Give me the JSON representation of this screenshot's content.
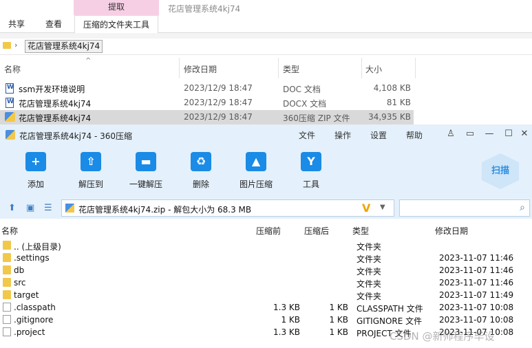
{
  "ribbon": {
    "context_tab": "提取",
    "window_title": "花店管理系统4kj74",
    "tabs": [
      "共享",
      "查看",
      "压缩的文件夹工具"
    ]
  },
  "address": {
    "crumb": "花店管理系统4kj74"
  },
  "explorer": {
    "columns": {
      "name": "名称",
      "date": "修改日期",
      "type": "类型",
      "size": "大小"
    },
    "rows": [
      {
        "name": "ssm开发环境说明",
        "date": "2023/12/9 18:47",
        "type": "DOC 文档",
        "size": "4,108 KB"
      },
      {
        "name": "花店管理系统4kj74",
        "date": "2023/12/9 18:47",
        "type": "DOCX 文档",
        "size": "81 KB"
      },
      {
        "name": "花店管理系统4kj74",
        "date": "2023/12/9 18:47",
        "type": "360压缩 ZIP 文件",
        "size": "34,935 KB"
      }
    ]
  },
  "zip": {
    "title": "花店管理系统4kj74 - 360压缩",
    "menu": [
      "文件",
      "操作",
      "设置",
      "帮助"
    ],
    "toolbar": [
      "添加",
      "解压到",
      "一键解压",
      "删除",
      "图片压缩",
      "工具"
    ],
    "scan_label": "扫描",
    "path": "花店管理系统4kj74.zip - 解包大小为 68.3 MB",
    "columns": {
      "name": "名称",
      "compressed": "压缩前",
      "original": "压缩后",
      "type": "类型",
      "date": "修改日期"
    },
    "rows": [
      {
        "name": ".. (上级目录)",
        "c": "",
        "o": "",
        "type": "文件夹",
        "date": "",
        "kind": "folder"
      },
      {
        "name": ".settings",
        "c": "",
        "o": "",
        "type": "文件夹",
        "date": "2023-11-07 11:46",
        "kind": "folder"
      },
      {
        "name": "db",
        "c": "",
        "o": "",
        "type": "文件夹",
        "date": "2023-11-07 11:46",
        "kind": "folder"
      },
      {
        "name": "src",
        "c": "",
        "o": "",
        "type": "文件夹",
        "date": "2023-11-07 11:46",
        "kind": "folder"
      },
      {
        "name": "target",
        "c": "",
        "o": "",
        "type": "文件夹",
        "date": "2023-11-07 11:49",
        "kind": "folder"
      },
      {
        "name": ".classpath",
        "c": "1.3 KB",
        "o": "1 KB",
        "type": "CLASSPATH 文件",
        "date": "2023-11-07 10:08",
        "kind": "file"
      },
      {
        "name": ".gitignore",
        "c": "1 KB",
        "o": "1 KB",
        "type": "GITIGNORE 文件",
        "date": "2023-11-07 10:08",
        "kind": "file"
      },
      {
        "name": ".project",
        "c": "1.3 KB",
        "o": "1 KB",
        "type": "PROJECT 文件",
        "date": "2023-11-07 10:08",
        "kind": "file"
      }
    ]
  },
  "watermark": "CSDN @新帅程序毕设"
}
